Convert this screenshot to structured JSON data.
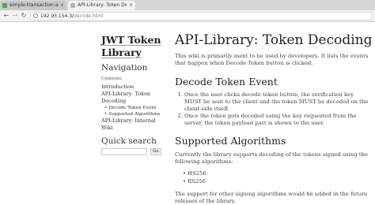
{
  "browser": {
    "tabs": [
      {
        "label": "simple-transaction-api",
        "close": "×"
      },
      {
        "label": "API-Library: Token Decoding",
        "close": "×"
      }
    ],
    "nav": {
      "back": "←",
      "forward": "→",
      "reload": "↻"
    },
    "url": {
      "host": "192.93.154.3/",
      "path": "decode.html"
    }
  },
  "sidebar": {
    "logo": "JWT Token Library",
    "navigation_heading": "Navigation",
    "contents_label": "Contents:",
    "toc": {
      "introduction": "Introduction",
      "token_decoding": "API-Library: Token Decoding",
      "decode_event": "Decode Token Event",
      "supported_algorithms": "Supported Algorithms",
      "internal_wiki": "API-Library: Internal Wiki"
    },
    "search_heading": "Quick search",
    "search_button": "Go"
  },
  "main": {
    "title": "API-Library: Token Decoding",
    "intro": "This wiki is primarily ment to be used by developers. It lists the events that happen when Decode Token button is clicked.",
    "decode_heading": "Decode Token Event",
    "steps": [
      "Once the user clicks decode token button, the verification key MUST be sent to the client and the token MUST be decoded on the client-side itself.",
      "Once the token gets decoded using the key requested from the server, the token payload part is shown to the user."
    ],
    "algorithms_heading": "Supported Algorithms",
    "algorithms_intro": "Currently the library supports decoding of the tokens signed using the following algorithms:",
    "algorithms": [
      "HS256",
      "RS256"
    ],
    "other_support": "The support for other signing algorithms would be added in the future releases of the library."
  }
}
